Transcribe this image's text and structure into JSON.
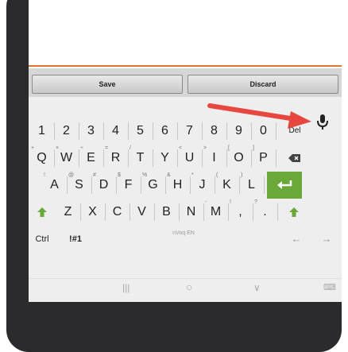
{
  "buttons": {
    "save": "Save",
    "discard": "Discard"
  },
  "row_numbers": [
    "1",
    "2",
    "3",
    "4",
    "5",
    "6",
    "7",
    "8",
    "9",
    "0"
  ],
  "del_label": "Del",
  "row_q": [
    {
      "k": "Q",
      "h": "+"
    },
    {
      "k": "W",
      "h": "×"
    },
    {
      "k": "E",
      "h": "÷"
    },
    {
      "k": "R",
      "h": "="
    },
    {
      "k": "T",
      "h": "/"
    },
    {
      "k": "Y",
      "h": ""
    },
    {
      "k": "U",
      "h": "<"
    },
    {
      "k": "I",
      "h": ">"
    },
    {
      "k": "O",
      "h": "["
    },
    {
      "k": "P",
      "h": "]"
    }
  ],
  "row_a": [
    {
      "k": "A",
      "h": "!"
    },
    {
      "k": "S",
      "h": "@"
    },
    {
      "k": "D",
      "h": "#"
    },
    {
      "k": "F",
      "h": "$"
    },
    {
      "k": "G",
      "h": "%"
    },
    {
      "k": "H",
      "h": "&"
    },
    {
      "k": "J",
      "h": "*"
    },
    {
      "k": "K",
      "h": "("
    },
    {
      "k": "L",
      "h": ")"
    }
  ],
  "row_z": [
    {
      "k": "Z",
      "h": ""
    },
    {
      "k": "X",
      "h": ""
    },
    {
      "k": "C",
      "h": ""
    },
    {
      "k": "V",
      "h": ""
    },
    {
      "k": "B",
      "h": ""
    },
    {
      "k": "N",
      "h": ""
    },
    {
      "k": "M",
      "h": "-"
    },
    {
      "k": ",",
      "h": "!"
    },
    {
      "k": ".",
      "h": "?"
    }
  ],
  "bottom": {
    "ctrl": "Ctrl",
    "sym": "!#1",
    "space": "nVoq EN",
    "left": "←",
    "right": "→"
  },
  "nav": {
    "recent": "|||",
    "home": "○",
    "back": "∨",
    "kbd": "⌨"
  },
  "colors": {
    "accent_orange": "#e0752c",
    "enter_green": "#6aa83a",
    "arrow_red": "#e8473f"
  }
}
